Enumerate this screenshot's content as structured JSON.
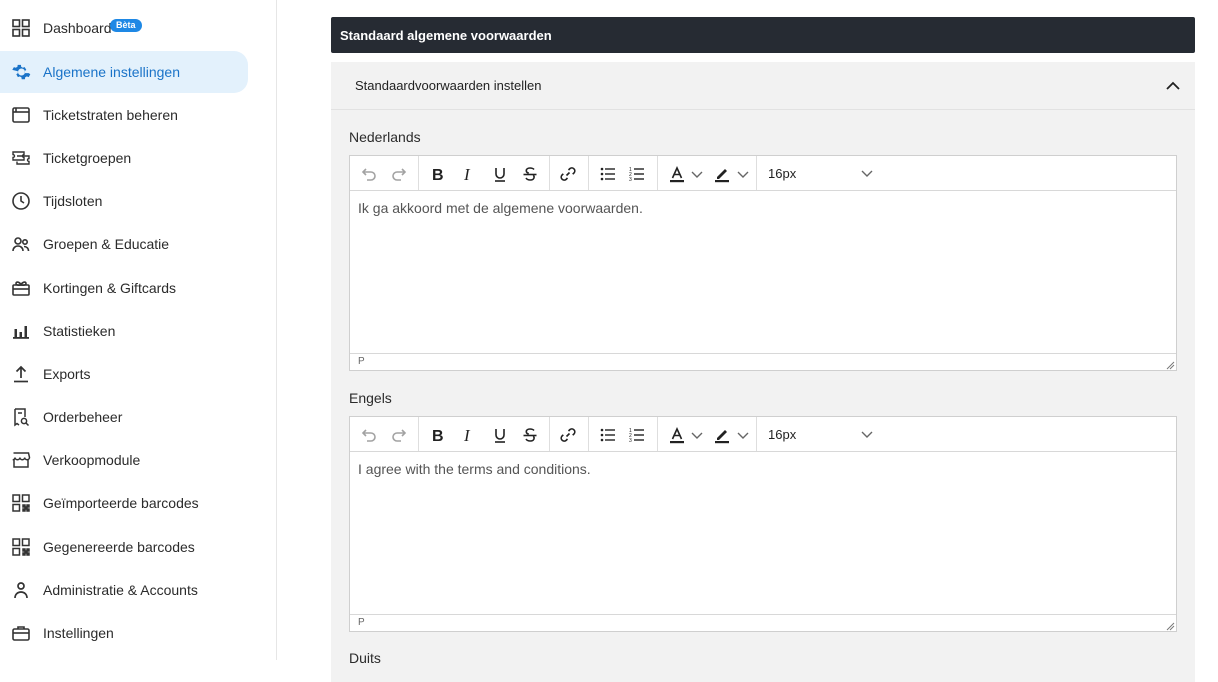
{
  "sidebar": {
    "items": [
      {
        "label": "Dashboard",
        "icon": "grid-icon",
        "badge": "Bèta",
        "active": false
      },
      {
        "label": "Algemene instellingen",
        "icon": "gear-icon",
        "active": true
      },
      {
        "label": "Ticketstraten beheren",
        "icon": "window-icon",
        "active": false
      },
      {
        "label": "Ticketgroepen",
        "icon": "tickets-icon",
        "active": false
      },
      {
        "label": "Tijdsloten",
        "icon": "clock-icon",
        "active": false
      },
      {
        "label": "Groepen & Educatie",
        "icon": "people-icon",
        "active": false
      },
      {
        "label": "Kortingen & Giftcards",
        "icon": "gift-icon",
        "active": false
      },
      {
        "label": "Statistieken",
        "icon": "bar-chart-icon",
        "active": false
      },
      {
        "label": "Exports",
        "icon": "upload-icon",
        "active": false
      },
      {
        "label": "Orderbeheer",
        "icon": "receipt-search-icon",
        "active": false
      },
      {
        "label": "Verkoopmodule",
        "icon": "store-icon",
        "active": false
      },
      {
        "label": "Geïmporteerde barcodes",
        "icon": "qr-icon",
        "active": false
      },
      {
        "label": "Gegenereerde barcodes",
        "icon": "qr-icon",
        "active": false
      },
      {
        "label": "Administratie & Accounts",
        "icon": "person-icon",
        "active": false
      },
      {
        "label": "Instellingen",
        "icon": "briefcase-icon",
        "active": false
      }
    ]
  },
  "main": {
    "panel_title": "Standaard algemene voorwaarden",
    "section_title": "Standaardvoorwaarden instellen",
    "editors": [
      {
        "label": "Nederlands",
        "content": "Ik ga akkoord met de algemene voorwaarden.",
        "font_size": "16px",
        "status": "P"
      },
      {
        "label": "Engels",
        "content": "I agree with the terms and conditions.",
        "font_size": "16px",
        "status": "P"
      }
    ],
    "next_label": "Duits"
  },
  "colors": {
    "accent": "#1a73c8",
    "active_bg": "#e3f1fc",
    "header_bg": "#262b33",
    "card_bg": "#f2f2f2"
  }
}
